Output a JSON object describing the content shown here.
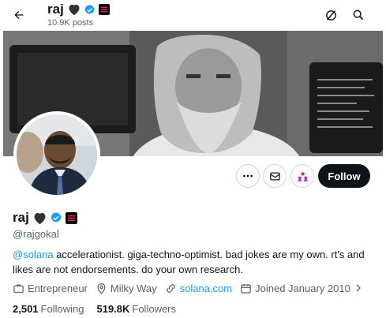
{
  "header": {
    "back_icon": "arrow-left-icon",
    "title": "raj",
    "posts": "10.9K posts",
    "grok_icon": "grok-icon",
    "search_icon": "search-icon"
  },
  "banner": {
    "alt_subject": "bearded man in front of computer monitors"
  },
  "actions": {
    "more_icon": "more-icon",
    "message_icon": "mail-icon",
    "subscribe_icon": "people-icon",
    "follow_label": "Follow"
  },
  "profile": {
    "name": "raj",
    "handle": "@rajgokal",
    "bio_link": "@solana",
    "bio_text": " accelerationist. giga-techno-optimist. bad jokes are my own. rt's and likes are not endorsements. do your own research.",
    "profession": "Entrepreneur",
    "location": "Milky Way",
    "website": "solana.com",
    "joined": "Joined January 2010",
    "following_count": "2,501",
    "following_label": "Following",
    "followers_count": "519.8K",
    "followers_label": "Followers"
  },
  "colors": {
    "accent": "#1d9bf0",
    "follow_bg": "#0f1419",
    "secondary_text": "#536471",
    "subscribe_icon": "#c026d3"
  }
}
